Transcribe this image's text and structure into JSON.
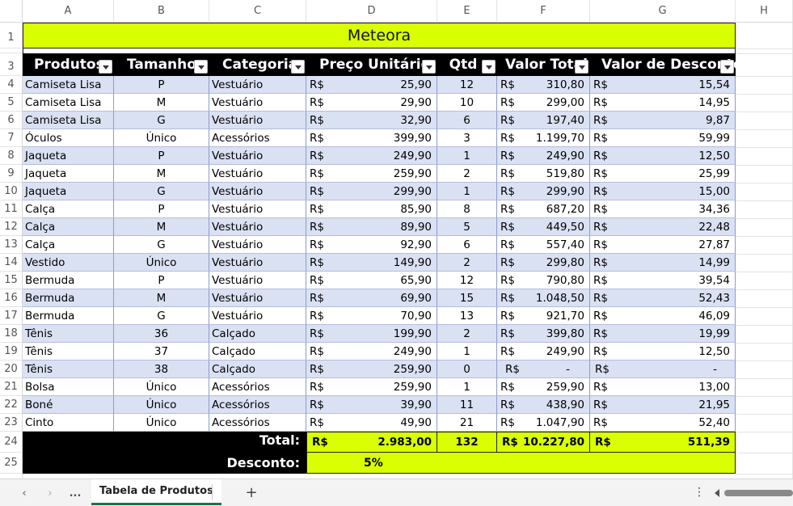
{
  "columns": [
    "A",
    "B",
    "C",
    "D",
    "E",
    "F",
    "G",
    "H"
  ],
  "rows": [
    "1",
    "2",
    "3",
    "4",
    "5",
    "6",
    "7",
    "8",
    "9",
    "10",
    "11",
    "12",
    "13",
    "14",
    "15",
    "16",
    "17",
    "18",
    "19",
    "20",
    "21",
    "22",
    "23",
    "24",
    "25"
  ],
  "title": "Meteora",
  "headers": [
    "Produtos",
    "Tamanho",
    "Categoria",
    "Preço Unitário",
    "Qtd",
    "Valor Total",
    "Valor de Desconto"
  ],
  "currency": "R$",
  "table": [
    {
      "produto": "Camiseta Lisa",
      "tamanho": "P",
      "categoria": "Vestuário",
      "preco": "25,90",
      "qtd": "12",
      "total": "310,80",
      "desconto": "15,54"
    },
    {
      "produto": "Camiseta Lisa",
      "tamanho": "M",
      "categoria": "Vestuário",
      "preco": "29,90",
      "qtd": "10",
      "total": "299,00",
      "desconto": "14,95"
    },
    {
      "produto": "Camiseta Lisa",
      "tamanho": "G",
      "categoria": "Vestuário",
      "preco": "32,90",
      "qtd": "6",
      "total": "197,40",
      "desconto": "9,87"
    },
    {
      "produto": "Óculos",
      "tamanho": "Único",
      "categoria": "Acessórios",
      "preco": "399,90",
      "qtd": "3",
      "total": "1.199,70",
      "desconto": "59,99"
    },
    {
      "produto": "Jaqueta",
      "tamanho": "P",
      "categoria": "Vestuário",
      "preco": "249,90",
      "qtd": "1",
      "total": "249,90",
      "desconto": "12,50"
    },
    {
      "produto": "Jaqueta",
      "tamanho": "M",
      "categoria": "Vestuário",
      "preco": "259,90",
      "qtd": "2",
      "total": "519,80",
      "desconto": "25,99"
    },
    {
      "produto": "Jaqueta",
      "tamanho": "G",
      "categoria": "Vestuário",
      "preco": "299,90",
      "qtd": "1",
      "total": "299,90",
      "desconto": "15,00"
    },
    {
      "produto": "Calça",
      "tamanho": "P",
      "categoria": "Vestuário",
      "preco": "85,90",
      "qtd": "8",
      "total": "687,20",
      "desconto": "34,36"
    },
    {
      "produto": "Calça",
      "tamanho": "M",
      "categoria": "Vestuário",
      "preco": "89,90",
      "qtd": "5",
      "total": "449,50",
      "desconto": "22,48"
    },
    {
      "produto": "Calça",
      "tamanho": "G",
      "categoria": "Vestuário",
      "preco": "92,90",
      "qtd": "6",
      "total": "557,40",
      "desconto": "27,87"
    },
    {
      "produto": "Vestido",
      "tamanho": "Único",
      "categoria": "Vestuário",
      "preco": "149,90",
      "qtd": "2",
      "total": "299,80",
      "desconto": "14,99"
    },
    {
      "produto": "Bermuda",
      "tamanho": "P",
      "categoria": "Vestuário",
      "preco": "65,90",
      "qtd": "12",
      "total": "790,80",
      "desconto": "39,54"
    },
    {
      "produto": "Bermuda",
      "tamanho": "M",
      "categoria": "Vestuário",
      "preco": "69,90",
      "qtd": "15",
      "total": "1.048,50",
      "desconto": "52,43"
    },
    {
      "produto": "Bermuda",
      "tamanho": "G",
      "categoria": "Vestuário",
      "preco": "70,90",
      "qtd": "13",
      "total": "921,70",
      "desconto": "46,09"
    },
    {
      "produto": "Tênis",
      "tamanho": "36",
      "categoria": "Calçado",
      "preco": "199,90",
      "qtd": "2",
      "total": "399,80",
      "desconto": "19,99"
    },
    {
      "produto": "Tênis",
      "tamanho": "37",
      "categoria": "Calçado",
      "preco": "249,90",
      "qtd": "1",
      "total": "249,90",
      "desconto": "12,50"
    },
    {
      "produto": "Tênis",
      "tamanho": "38",
      "categoria": "Calçado",
      "preco": "259,90",
      "qtd": "0",
      "total": "-",
      "desconto": "-"
    },
    {
      "produto": "Bolsa",
      "tamanho": "Único",
      "categoria": "Acessórios",
      "preco": "259,90",
      "qtd": "1",
      "total": "259,90",
      "desconto": "13,00"
    },
    {
      "produto": "Boné",
      "tamanho": "Único",
      "categoria": "Acessórios",
      "preco": "39,90",
      "qtd": "11",
      "total": "438,90",
      "desconto": "21,95"
    },
    {
      "produto": "Cinto",
      "tamanho": "Único",
      "categoria": "Acessórios",
      "preco": "49,90",
      "qtd": "21",
      "total": "1.047,90",
      "desconto": "52,40"
    }
  ],
  "totals": {
    "label": "Total:",
    "preco": "2.983,00",
    "qtd": "132",
    "total": "10.227,80",
    "desconto": "511,39"
  },
  "discount": {
    "label": "Desconto:",
    "value": "5%"
  },
  "footer": {
    "sheet_tab": "Tabela de Produtos",
    "more": "...",
    "add": "+",
    "vmore": "⋮"
  },
  "colors": {
    "title_bg": "#d9ff00",
    "header_bg": "#000000",
    "band": "#dae1f3",
    "sheet_tab_accent": "#1e7145"
  }
}
